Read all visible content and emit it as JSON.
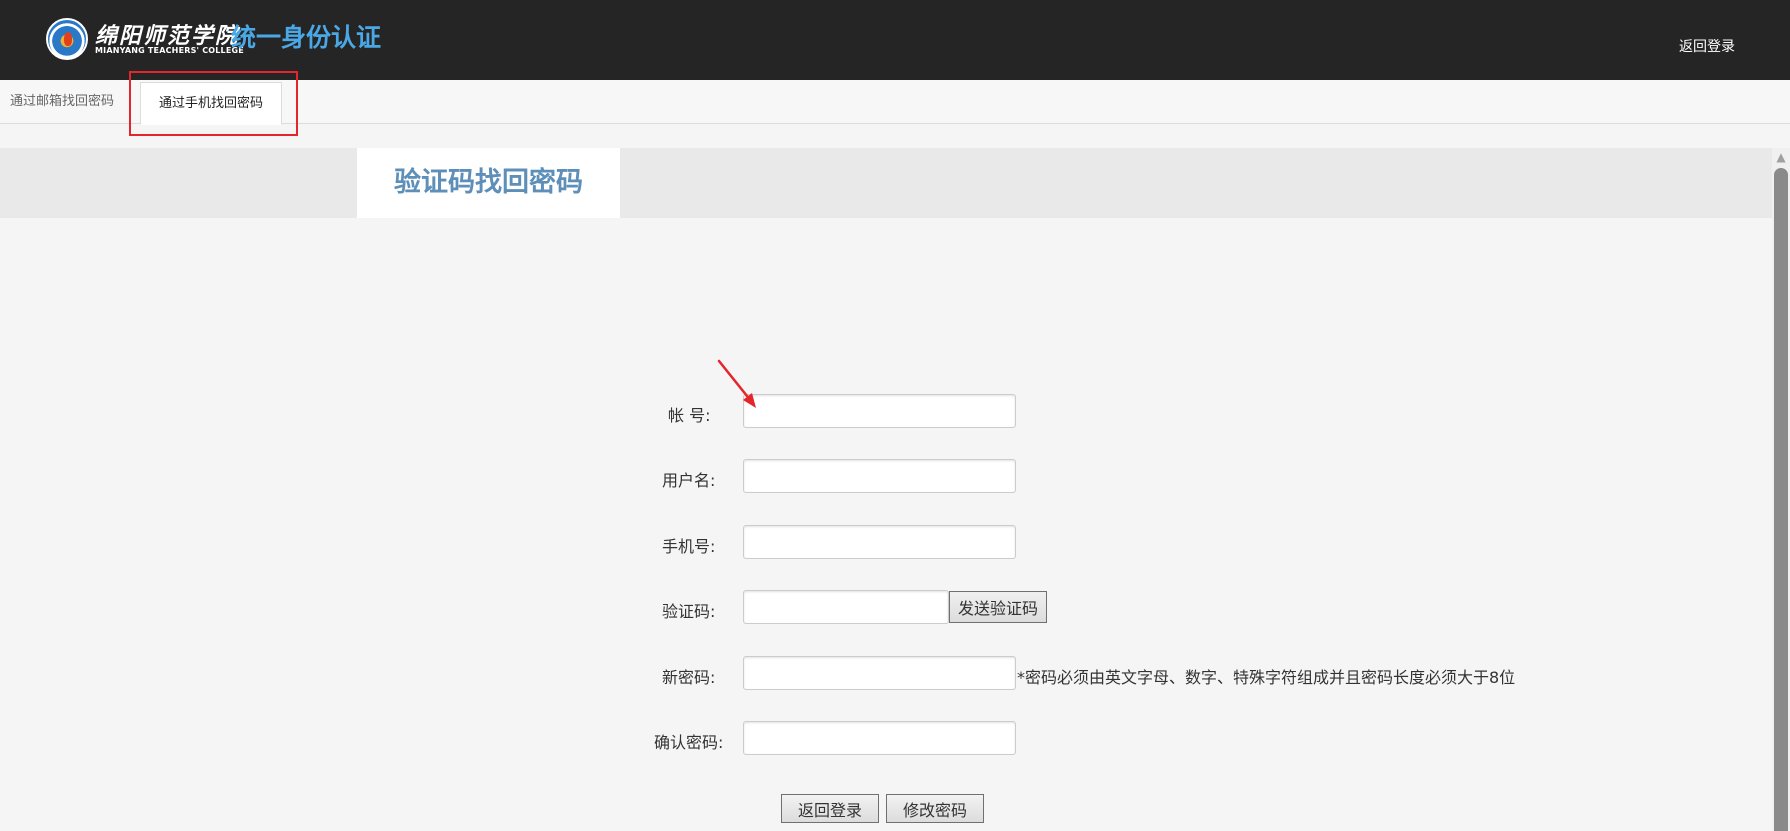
{
  "header": {
    "school_name_cn": "绵阳师范学院",
    "school_name_en": "MIANYANG TEACHERS' COLLEGE",
    "system_title": "统一身份认证",
    "back_login_link": "返回登录"
  },
  "tabs": [
    {
      "label": "通过邮箱找回密码",
      "active": false
    },
    {
      "label": "通过手机找回密码",
      "active": true
    }
  ],
  "page_title": "验证码找回密码",
  "form": {
    "account_label": "帐 号:",
    "username_label": "用户名:",
    "phone_label": "手机号:",
    "code_label": "验证码:",
    "send_code_button": "发送验证码",
    "new_password_label": "新密码:",
    "password_hint": "*密码必须由英文字母、数字、特殊字符组成并且密码长度必须大于8位",
    "confirm_password_label": "确认密码:",
    "account_value": "",
    "username_value": "",
    "phone_value": "",
    "code_value": "",
    "new_password_value": "",
    "confirm_password_value": ""
  },
  "buttons": {
    "back_login": "返回登录",
    "change_password": "修改密码"
  },
  "colors": {
    "header_bg": "#252525",
    "title_blue": "#4aa8e6",
    "page_title_color": "#5d8fb8",
    "annotation_red": "#e3262b"
  },
  "icons": {
    "logo": "college-emblem-icon",
    "annotation": "red-arrow-icon",
    "scroll_up": "chevron-up-icon"
  }
}
